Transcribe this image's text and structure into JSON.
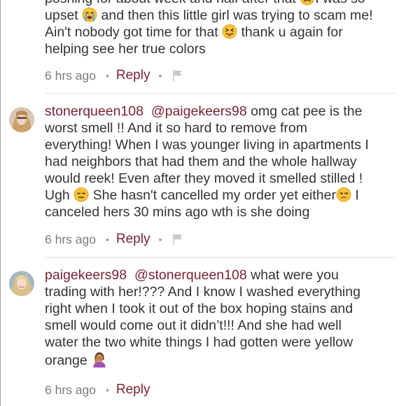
{
  "comments": [
    {
      "username": "",
      "lines": [
        {
          "text": "poshing for about week and half after that "
        },
        {
          "a": "I was so"
        },
        {
          "a": "upset ",
          "b": " and then this little girl was trying to scam me!"
        },
        {
          "a": "Ain't nobody got time for that ",
          "b": " thank u again for"
        },
        {
          "a": "helping see her true colors"
        }
      ],
      "time": "6 hrs ago",
      "reply_label": "Reply"
    },
    {
      "username": "stonerqueen108",
      "mention": "@paigekeers98",
      "lines": [
        {
          "a": " omg cat pee is the"
        },
        {
          "a": "worst smell !! And it so hard to remove from"
        },
        {
          "a": "everything! When I was younger living in apartments I"
        },
        {
          "a": "had neighbors that had them and the whole hallway"
        },
        {
          "a": "would reek! Even after they moved it smelled stilled !"
        },
        {
          "a": "Ugh ",
          "b": " She hasn't cancelled my order yet either",
          "c": " I"
        },
        {
          "a": "canceled hers 30 mins ago wth is she doing"
        }
      ],
      "time": "6 hrs ago",
      "reply_label": "Reply"
    },
    {
      "username": "paigekeers98",
      "mention": "@stonerqueen108",
      "lines": [
        {
          "a": " what were you"
        },
        {
          "a": "trading with her!??? And I know I washed everything"
        },
        {
          "a": "right when I took it out of the box hoping stains and"
        },
        {
          "a": "smell would come out it didn’t!!! And she had well"
        },
        {
          "a": "water the two white things I had gotten were yellow"
        },
        {
          "a": "orange "
        }
      ],
      "time": "6 hrs ago",
      "reply_label": "Reply"
    }
  ],
  "colors": {
    "accent": "#7a2333",
    "text": "#333333",
    "muted": "#7a7a7a",
    "divider": "#e3e3e3"
  },
  "icons": {
    "flag": "flag-icon",
    "emoji_frown": "frowning-face-emoji",
    "emoji_sob": "loudly-crying-face-emoji",
    "emoji_tongue": "squinting-tongue-face-emoji",
    "emoji_expressionless": "expressionless-face-emoji",
    "emoji_unamused": "unamused-face-emoji",
    "emoji_facepalm": "woman-facepalming-emoji"
  }
}
